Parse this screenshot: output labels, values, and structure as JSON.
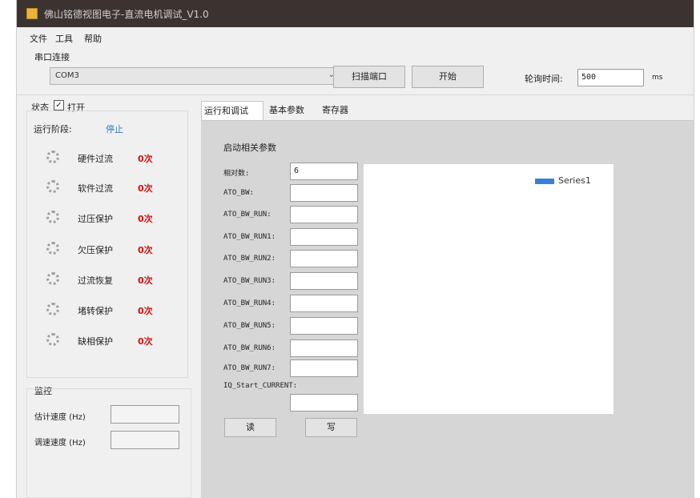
{
  "window": {
    "title": "佛山铭德视图电子-直流电机调试_V1.0"
  },
  "menu": [
    "文件",
    "工具",
    "帮助"
  ],
  "serial": {
    "section_label": "串口连接",
    "port_value": "COM3",
    "scan_label": "扫描端口",
    "start_label": "开始",
    "poll_label": "轮询时间:",
    "poll_value": "500",
    "poll_unit": "ms"
  },
  "status": {
    "label": "状态",
    "open_label": "打开",
    "open_checked": true,
    "stage_label": "运行阶段:",
    "stage_value": "停止"
  },
  "protections": [
    {
      "label": "硬件过流",
      "count": "0次"
    },
    {
      "label": "软件过流",
      "count": "0次"
    },
    {
      "label": "过压保护",
      "count": "0次"
    },
    {
      "label": "欠压保护",
      "count": "0次"
    },
    {
      "label": "过流恢复",
      "count": "0次"
    },
    {
      "label": "堵转保护",
      "count": "0次"
    },
    {
      "label": "缺相保护",
      "count": "0次"
    }
  ],
  "monitor": {
    "title": "监控",
    "est_speed_label": "估计速度 (Hz)",
    "est_speed_value": "",
    "target_speed_label": "调速速度 (Hz)",
    "target_speed_value": ""
  },
  "tabs": [
    "运行和调试",
    "基本参数",
    "寄存器"
  ],
  "startup": {
    "title": "启动相关参数",
    "params": [
      {
        "label": "相对数:",
        "value": "6"
      },
      {
        "label": "ATO_BW:",
        "value": ""
      },
      {
        "label": "ATO_BW_RUN:",
        "value": ""
      },
      {
        "label": "ATO_BW_RUN1:",
        "value": ""
      },
      {
        "label": "ATO_BW_RUN2:",
        "value": ""
      },
      {
        "label": "ATO_BW_RUN3:",
        "value": ""
      },
      {
        "label": "ATO_BW_RUN4:",
        "value": ""
      },
      {
        "label": "ATO_BW_RUN5:",
        "value": ""
      },
      {
        "label": "ATO_BW_RUN6:",
        "value": ""
      },
      {
        "label": "ATO_BW_RUN7:",
        "value": ""
      },
      {
        "label": "IQ_Start_CURRENT:",
        "value": ""
      }
    ],
    "read_label": "读",
    "write_label": "写"
  },
  "chart": {
    "legend": "Series1",
    "series_color": "#3c7fd6"
  }
}
